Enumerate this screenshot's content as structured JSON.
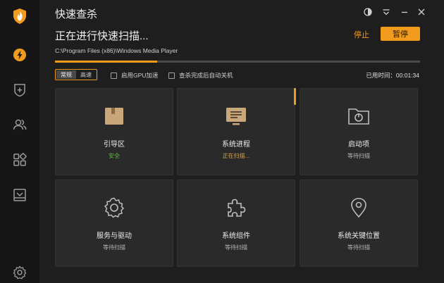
{
  "app": {
    "title": "快速查杀"
  },
  "sidebar": {
    "items": [
      {
        "icon": "lightning-icon",
        "active": true
      },
      {
        "icon": "shield-plus-icon"
      },
      {
        "icon": "users-icon"
      },
      {
        "icon": "apps-grid-icon"
      },
      {
        "icon": "inbox-tray-icon"
      }
    ],
    "settings_icon": "gear-icon"
  },
  "window_controls": [
    "theme-toggle-icon",
    "menu-dropdown-icon",
    "minimize-icon",
    "close-icon"
  ],
  "scan": {
    "heading": "正在进行快速扫描...",
    "path": "C:\\Program Files (x86)\\Windows Media Player",
    "progress": 0.28,
    "stop_label": "停止",
    "pause_label": "暂停",
    "elapsed": "已用时间：00:01:34"
  },
  "options": {
    "mode_normal": "常规",
    "mode_fast": "高速",
    "gpu_label": "启用GPU加速",
    "shutdown_label": "查杀完成后自动关机"
  },
  "cards": [
    {
      "title": "引导区",
      "status": "安全",
      "state": "safe",
      "icon": "boot-box-icon"
    },
    {
      "title": "系统进程",
      "status": "正在扫描...",
      "state": "scanning",
      "icon": "monitor-process-icon"
    },
    {
      "title": "启动项",
      "status": "等待扫描",
      "state": "waiting",
      "icon": "startup-folder-icon"
    },
    {
      "title": "服务与驱动",
      "status": "等待扫描",
      "state": "waiting",
      "icon": "gear-service-icon"
    },
    {
      "title": "系统组件",
      "status": "等待扫描",
      "state": "waiting",
      "icon": "puzzle-icon"
    },
    {
      "title": "系统关键位置",
      "status": "等待扫描",
      "state": "waiting",
      "icon": "location-pin-icon"
    }
  ],
  "colors": {
    "accent": "#f29c1f",
    "safe": "#5dbb3f",
    "scanning": "#d9a24a"
  }
}
